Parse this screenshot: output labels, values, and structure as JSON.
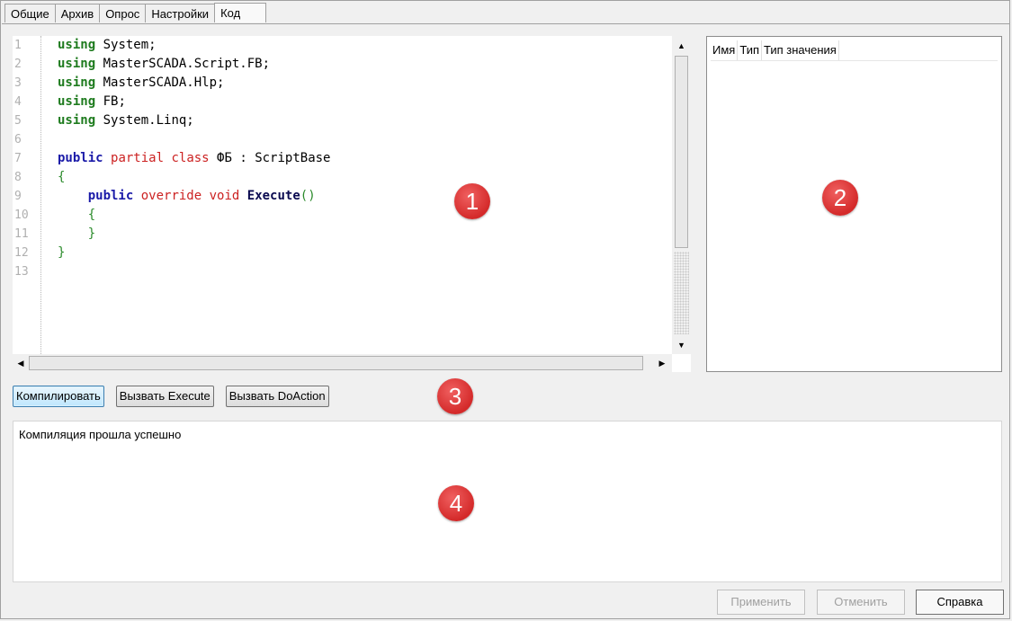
{
  "tabs": [
    "Общие",
    "Архив",
    "Опрос",
    "Настройки",
    "Код"
  ],
  "editor": {
    "line_numbers": [
      "1",
      "2",
      "3",
      "4",
      "5",
      "6",
      "7",
      "8",
      "9",
      "10",
      "11",
      "12",
      "13"
    ],
    "lines": [
      [
        {
          "t": "using",
          "c": "kw-green"
        },
        {
          "t": " System;"
        }
      ],
      [
        {
          "t": "using",
          "c": "kw-green"
        },
        {
          "t": " MasterSCADA.Script.FB;"
        }
      ],
      [
        {
          "t": "using",
          "c": "kw-green"
        },
        {
          "t": " MasterSCADA.Hlp;"
        }
      ],
      [
        {
          "t": "using",
          "c": "kw-green"
        },
        {
          "t": " FB;"
        }
      ],
      [
        {
          "t": "using",
          "c": "kw-green"
        },
        {
          "t": " System.Linq;"
        }
      ],
      [],
      [
        {
          "t": "public",
          "c": "kw-blue"
        },
        {
          "t": " "
        },
        {
          "t": "partial",
          "c": "kw-red"
        },
        {
          "t": " "
        },
        {
          "t": "class",
          "c": "kw-red"
        },
        {
          "t": " ФБ : ScriptBase"
        }
      ],
      [
        {
          "t": "{",
          "c": "punct-green"
        }
      ],
      [
        {
          "t": "    "
        },
        {
          "t": "public",
          "c": "kw-blue"
        },
        {
          "t": " "
        },
        {
          "t": "override",
          "c": "kw-red"
        },
        {
          "t": " "
        },
        {
          "t": "void",
          "c": "kw-red"
        },
        {
          "t": " "
        },
        {
          "t": "Execute",
          "c": "fn-bold"
        },
        {
          "t": "()",
          "c": "punct-green"
        }
      ],
      [
        {
          "t": "    "
        },
        {
          "t": "{",
          "c": "punct-green"
        }
      ],
      [
        {
          "t": "    "
        },
        {
          "t": "}",
          "c": "punct-green"
        }
      ],
      [
        {
          "t": "}",
          "c": "punct-green"
        }
      ],
      []
    ]
  },
  "variables": {
    "columns": [
      "Имя",
      "Тип",
      "Тип значения"
    ]
  },
  "actions": {
    "compile": "Компилировать",
    "call_execute": "Вызвать Execute",
    "call_doaction": "Вызвать DoAction"
  },
  "output": {
    "message": "Компиляция прошла успешно"
  },
  "dialog": {
    "apply": "Применить",
    "cancel": "Отменить",
    "help": "Справка"
  },
  "markers": [
    "1",
    "2",
    "3",
    "4"
  ],
  "colors": {
    "marker": "#d42a2a",
    "keyword_green": "#1e7b1e",
    "keyword_blue": "#1a1aa8",
    "keyword_red": "#cc2222"
  }
}
